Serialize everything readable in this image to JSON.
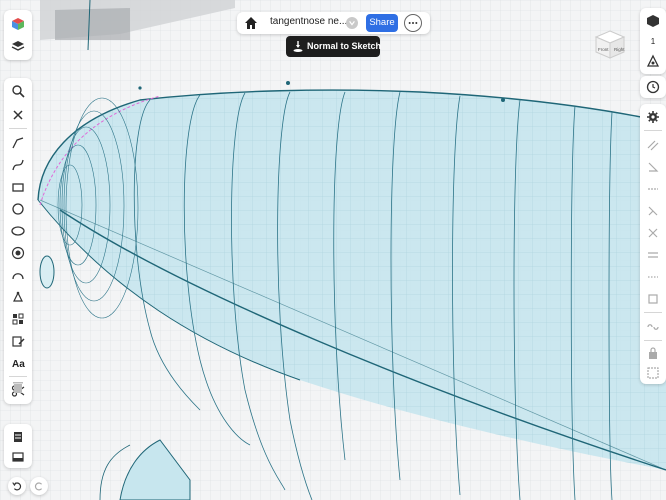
{
  "document": {
    "title": "tangentnose ne..."
  },
  "topbar": {
    "share_label": "Share"
  },
  "view": {
    "normal_to_sketch_label": "Normal to Sketch"
  },
  "view_cube": {
    "face_left": "Front",
    "face_right": "Right"
  },
  "right_toolbar": {
    "scale_value": "1"
  },
  "colors": {
    "accent": "#2f6fe4",
    "surface": "#bfe2ea",
    "edge": "#1f6677"
  }
}
